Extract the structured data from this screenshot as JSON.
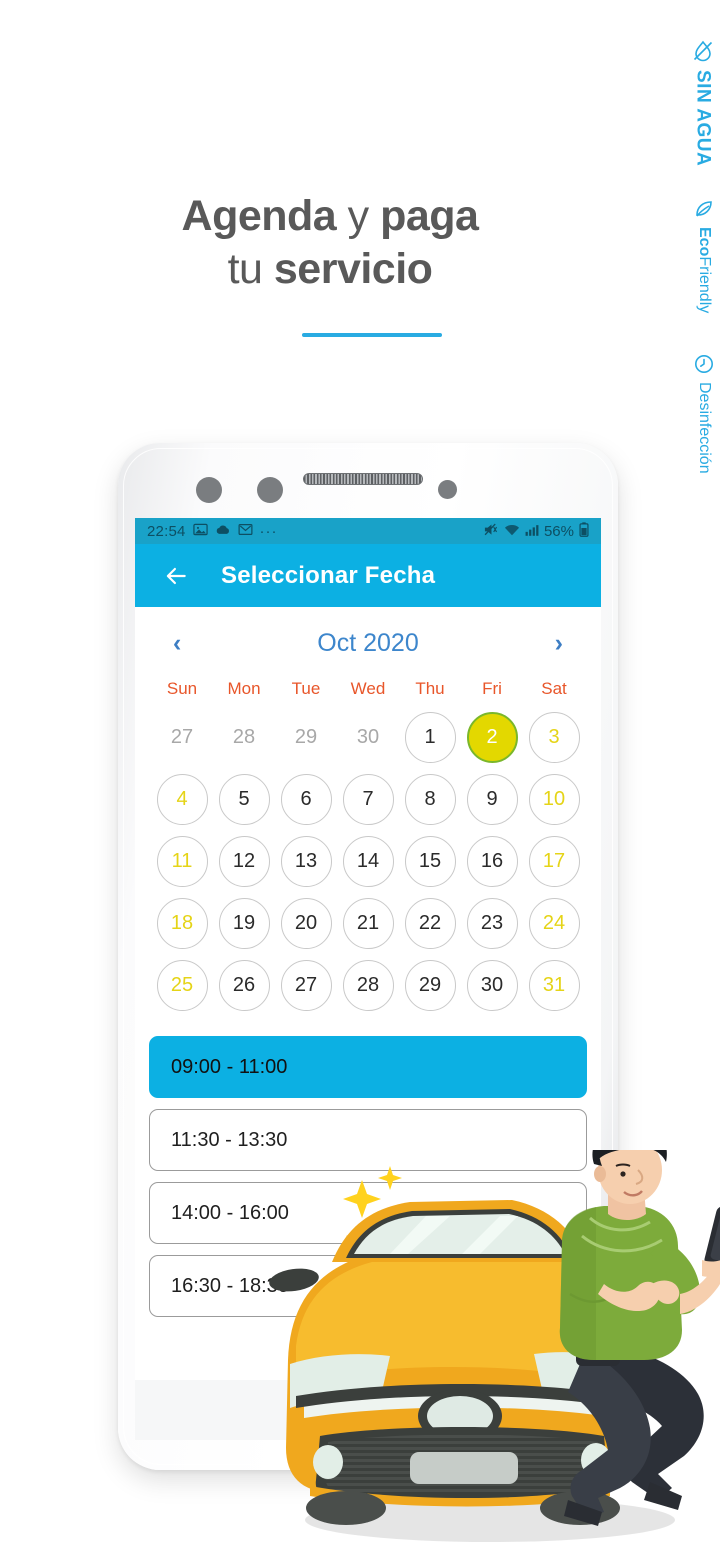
{
  "side_rail": {
    "items": [
      {
        "label": "SIN AGUA",
        "icon": "no-water-drop-icon"
      },
      {
        "label": "Eco",
        "label2": "Friendly",
        "icon": "leaf-icon"
      },
      {
        "label": "Desinfección",
        "icon": "disinfect-clock-icon"
      }
    ],
    "color": "#29abe2"
  },
  "headline": {
    "line1_bold_a": "Agenda",
    "line1_light": " y ",
    "line1_bold_b": "paga",
    "line2_light": "tu ",
    "line2_bold": "servicio"
  },
  "phone": {
    "statusbar": {
      "time": "22:54",
      "icons_left": [
        "image-icon",
        "cloud-icon",
        "gmail-icon",
        "overflow-dots-icon"
      ],
      "dots": "···",
      "icons_right": [
        "mute-icon",
        "wifi-icon",
        "signal-icon"
      ],
      "battery_percent": "56%",
      "battery_icon": "battery-icon",
      "bg_color": "#19a2c8"
    },
    "appbar": {
      "back_icon": "back-arrow-icon",
      "title": "Seleccionar Fecha",
      "bg_color": "#0cb0e3"
    },
    "calendar": {
      "prev_icon": "chevron-left-icon",
      "next_icon": "chevron-right-icon",
      "month_label": "Oct 2020",
      "weekdays": [
        "Sun",
        "Mon",
        "Tue",
        "Wed",
        "Thu",
        "Fri",
        "Sat"
      ],
      "weekday_color": "#e8562a",
      "month_color": "#3d86cc",
      "selected_day": "2",
      "selected_colors": {
        "fill": "#e3d800",
        "border": "#7ab72a",
        "text": "#ffffff"
      },
      "weekend_text_color": "#e5d417",
      "weeks": [
        [
          {
            "n": "27",
            "state": "muted"
          },
          {
            "n": "28",
            "state": "muted"
          },
          {
            "n": "29",
            "state": "muted"
          },
          {
            "n": "30",
            "state": "muted"
          },
          {
            "n": "1",
            "state": "normal"
          },
          {
            "n": "2",
            "state": "selected"
          },
          {
            "n": "3",
            "state": "weekend"
          }
        ],
        [
          {
            "n": "4",
            "state": "weekend"
          },
          {
            "n": "5",
            "state": "normal"
          },
          {
            "n": "6",
            "state": "normal"
          },
          {
            "n": "7",
            "state": "normal"
          },
          {
            "n": "8",
            "state": "normal"
          },
          {
            "n": "9",
            "state": "normal"
          },
          {
            "n": "10",
            "state": "weekend"
          }
        ],
        [
          {
            "n": "11",
            "state": "weekend"
          },
          {
            "n": "12",
            "state": "normal"
          },
          {
            "n": "13",
            "state": "normal"
          },
          {
            "n": "14",
            "state": "normal"
          },
          {
            "n": "15",
            "state": "normal"
          },
          {
            "n": "16",
            "state": "normal"
          },
          {
            "n": "17",
            "state": "weekend"
          }
        ],
        [
          {
            "n": "18",
            "state": "weekend"
          },
          {
            "n": "19",
            "state": "normal"
          },
          {
            "n": "20",
            "state": "normal"
          },
          {
            "n": "21",
            "state": "normal"
          },
          {
            "n": "22",
            "state": "normal"
          },
          {
            "n": "23",
            "state": "normal"
          },
          {
            "n": "24",
            "state": "weekend"
          }
        ],
        [
          {
            "n": "25",
            "state": "weekend"
          },
          {
            "n": "26",
            "state": "normal"
          },
          {
            "n": "27",
            "state": "normal"
          },
          {
            "n": "28",
            "state": "normal"
          },
          {
            "n": "29",
            "state": "normal"
          },
          {
            "n": "30",
            "state": "normal"
          },
          {
            "n": "31",
            "state": "weekend"
          }
        ]
      ]
    },
    "time_slots": [
      {
        "label": "09:00 - 11:00",
        "selected": true
      },
      {
        "label": "11:30 - 13:30",
        "selected": false
      },
      {
        "label": "14:00 - 16:00",
        "selected": false
      },
      {
        "label": "16:30 - 18:30",
        "selected": false
      }
    ],
    "navbar": {
      "recents_glyph": "|||"
    }
  },
  "illustration": {
    "car_color": "#f5a623",
    "shirt_color": "#7dab3b",
    "description_icons": [
      "yellow-car-icon",
      "seated-man-with-phone-icon",
      "sparkle-icon"
    ]
  }
}
